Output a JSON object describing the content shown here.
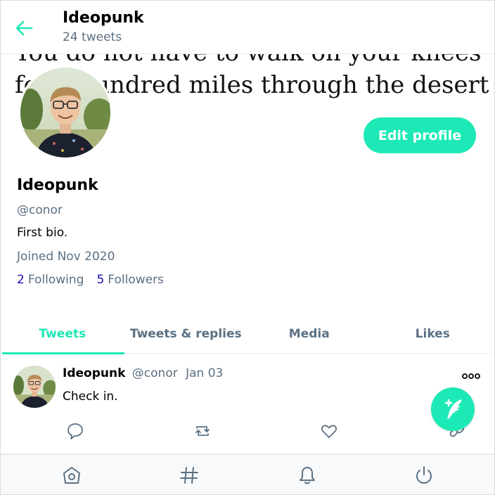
{
  "header": {
    "title": "Ideopunk",
    "tweet_count": "24 tweets"
  },
  "banner": {
    "line1": "You do not have to walk on your knees",
    "line2": "for a hundred miles through the desert repenting."
  },
  "profile": {
    "edit_label": "Edit profile",
    "name": "Ideopunk",
    "handle": "@conor",
    "bio": "First bio.",
    "joined": "Joined Nov 2020",
    "following_count": "2",
    "following_label": "Following",
    "followers_count": "5",
    "followers_label": "Followers"
  },
  "tabs": [
    {
      "label": "Tweets",
      "active": true
    },
    {
      "label": "Tweets & replies",
      "active": false
    },
    {
      "label": "Media",
      "active": false
    },
    {
      "label": "Likes",
      "active": false
    }
  ],
  "tweets": [
    {
      "name": "Ideopunk",
      "handle": "@conor",
      "date": "Jan 03",
      "text": "Check in."
    }
  ],
  "icons": {
    "back": "arrow-left-icon",
    "more": "more-dots-icon",
    "reply": "comment-icon",
    "retweet": "retweet-icon",
    "like": "heart-icon",
    "share": "link-icon",
    "compose": "feather-plus-icon",
    "home": "home-icon",
    "explore": "hashtag-icon",
    "notifications": "bell-icon",
    "logout": "power-icon"
  },
  "colors": {
    "accent": "#1de9b6",
    "muted": "#5b7083",
    "link": "#1a0dab"
  }
}
